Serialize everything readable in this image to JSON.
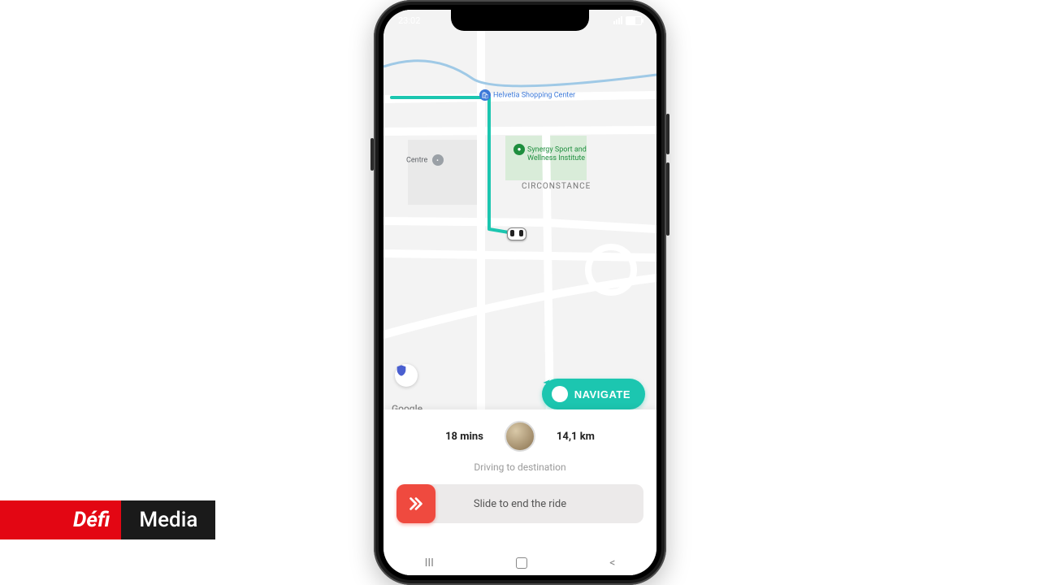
{
  "status": {
    "time": "23:02"
  },
  "map": {
    "poi_shopping": "Helvetia Shopping Center",
    "poi_centre": "Centre",
    "poi_sport_l1": "Synergy Sport and",
    "poi_sport_l2": "Wellness Institute",
    "district": "CIRCONSTANCE",
    "attribution": "Google",
    "route_color": "#1cc6b0"
  },
  "navigate": {
    "label": "NAVIGATE"
  },
  "trip": {
    "duration": "18 mins",
    "distance": "14,1 km",
    "status": "Driving to destination"
  },
  "slider": {
    "label": "Slide to end the ride"
  },
  "watermark": {
    "part1": "Défi",
    "part2": "Media"
  }
}
